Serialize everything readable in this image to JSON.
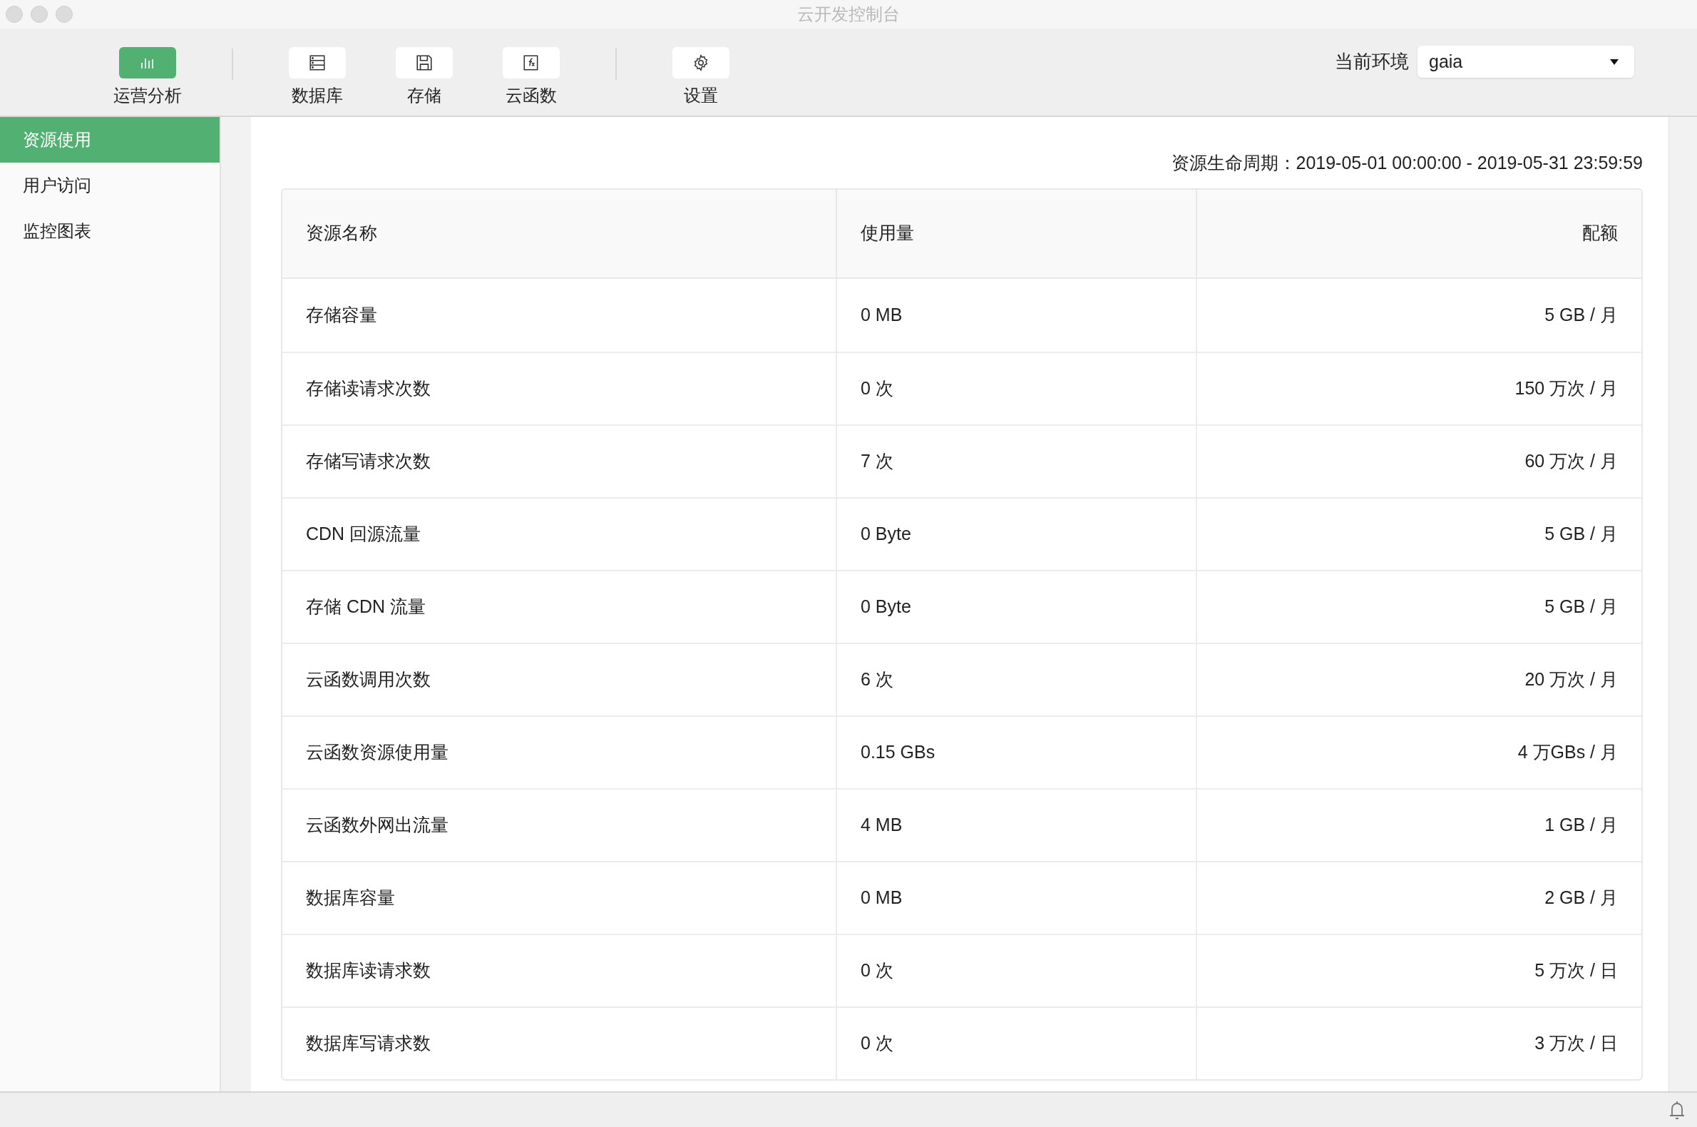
{
  "window": {
    "title": "云开发控制台"
  },
  "toolbar": {
    "groups": [
      [
        {
          "label": "运营分析",
          "kind": "chart",
          "selected": true
        }
      ],
      [
        {
          "label": "数据库",
          "kind": "database",
          "selected": false
        },
        {
          "label": "存储",
          "kind": "save",
          "selected": false
        },
        {
          "label": "云函数",
          "kind": "function",
          "selected": false
        }
      ],
      [
        {
          "label": "设置",
          "kind": "gear",
          "selected": false
        }
      ]
    ]
  },
  "environment": {
    "label": "当前环境",
    "value": "gaia"
  },
  "sidebar": {
    "items": [
      {
        "label": "资源使用",
        "selected": true
      },
      {
        "label": "用户访问",
        "selected": false
      },
      {
        "label": "监控图表",
        "selected": false
      }
    ]
  },
  "lifecycle": "资源生命周期：2019-05-01 00:00:00 - 2019-05-31 23:59:59",
  "table": {
    "columns": [
      "资源名称",
      "使用量",
      "配额"
    ],
    "rows": [
      [
        "存储容量",
        "0 MB",
        "5 GB / 月"
      ],
      [
        "存储读请求次数",
        "0 次",
        "150 万次 / 月"
      ],
      [
        "存储写请求次数",
        "7 次",
        "60 万次 / 月"
      ],
      [
        "CDN 回源流量",
        "0 Byte",
        "5 GB / 月"
      ],
      [
        "存储 CDN 流量",
        "0 Byte",
        "5 GB / 月"
      ],
      [
        "云函数调用次数",
        "6 次",
        "20 万次 / 月"
      ],
      [
        "云函数资源使用量",
        "0.15 GBs",
        "4 万GBs / 月"
      ],
      [
        "云函数外网出流量",
        "4 MB",
        "1 GB / 月"
      ],
      [
        "数据库容量",
        "0 MB",
        "2 GB / 月"
      ],
      [
        "数据库读请求数",
        "0 次",
        "5 万次 / 日"
      ],
      [
        "数据库写请求数",
        "0 次",
        "3 万次 / 日"
      ]
    ]
  }
}
